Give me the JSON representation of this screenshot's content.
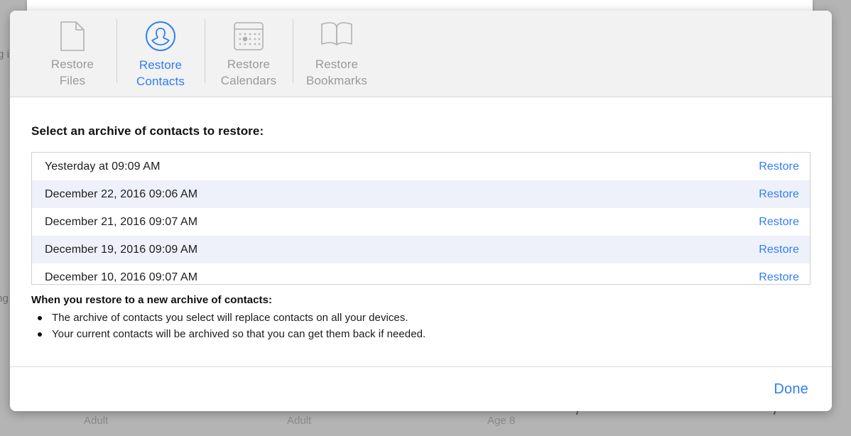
{
  "background": {
    "left_fragment_top": "g i",
    "left_fragment_bottom": "ng",
    "bottom_captions": [
      "Adult",
      "Adult",
      "Age 8"
    ]
  },
  "dialog": {
    "toolbar": {
      "tabs": [
        {
          "label_line1": "Restore",
          "label_line2": "Files",
          "icon": "document-icon",
          "active": false
        },
        {
          "label_line1": "Restore",
          "label_line2": "Contacts",
          "icon": "contact-icon",
          "active": true
        },
        {
          "label_line1": "Restore",
          "label_line2": "Calendars",
          "icon": "calendar-icon",
          "active": false
        },
        {
          "label_line1": "Restore",
          "label_line2": "Bookmarks",
          "icon": "bookmark-icon",
          "active": false
        }
      ]
    },
    "prompt": "Select an archive of contacts to restore:",
    "archives": [
      {
        "date": "Yesterday at 09:09 AM",
        "action": "Restore"
      },
      {
        "date": "December 22, 2016 09:06 AM",
        "action": "Restore"
      },
      {
        "date": "December 21, 2016 09:07 AM",
        "action": "Restore"
      },
      {
        "date": "December 19, 2016 09:09 AM",
        "action": "Restore"
      },
      {
        "date": "December 10, 2016 09:07 AM",
        "action": "Restore"
      }
    ],
    "notes": {
      "title": "When you restore to a new archive of contacts:",
      "items": [
        "The archive of contacts you select will replace contacts on all your devices.",
        "Your current contacts will be archived so that you can get them back if needed."
      ]
    },
    "footer": {
      "done_label": "Done"
    }
  },
  "colors": {
    "accent_blue": "#2d7ef7",
    "inactive_grey": "#9a9a9a",
    "toolbar_bg": "#f2f2f2",
    "row_alt": "#eef1fa",
    "desktop_grey": "#b4b4b4"
  }
}
